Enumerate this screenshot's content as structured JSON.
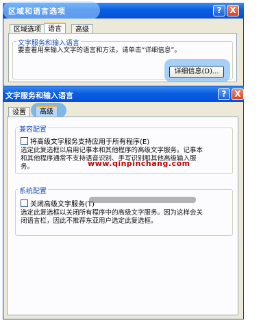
{
  "back_dialog": {
    "title": "区域和语言选项",
    "tabs": [
      {
        "label": "区域选项",
        "active": false
      },
      {
        "label": "语言",
        "active": true
      },
      {
        "label": "高级",
        "active": false
      }
    ],
    "group_title": "文字服务和输入语言",
    "description": "要查看用来输入文字的语言和方法，请单击“详细信息”。",
    "details_button": "详细信息(D)..."
  },
  "front_dialog": {
    "title": "文字服务和输入语言",
    "tabs": [
      {
        "label": "设置",
        "active": false
      },
      {
        "label": "高级",
        "active": true
      }
    ],
    "compat_group": {
      "title": "兼容配置",
      "checkbox_label": "将高级文字服务支持应用于所有程序(E)",
      "checked": false,
      "desc_line1": "选定此复选框以启用记事本和其他程序的高级文字服务。记事本",
      "desc_line2": "和其他程序通常不支持语音识别、手写识别和其他高级输入服",
      "desc_line3": "务。"
    },
    "system_group": {
      "title": "系统配置",
      "checkbox_label": "关闭高级文字服务(T)",
      "checked": false,
      "desc_line1": "选定此复选框以关闭所有程序中的高级文字服务。因为这样会关",
      "desc_line2": "闭语言栏，因此不推荐东亚用户选定此复选框。"
    }
  },
  "watermark": "www.qinpinchang.com",
  "titlebar_buttons": {
    "help": "?",
    "close": "X"
  },
  "colors": {
    "titlebar": "#0a5ee0",
    "dialog_bg": "#ece9d8",
    "group_title": "#1e4fbd",
    "watermark": "#c00000"
  }
}
